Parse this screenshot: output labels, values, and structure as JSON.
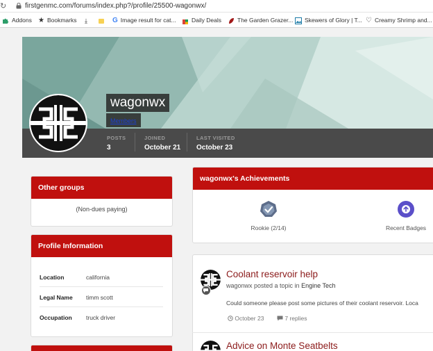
{
  "browser": {
    "url": "firstgenmc.com/forums/index.php?/profile/25500-wagonwx/",
    "bookmarks": [
      {
        "label": "Addons",
        "icon": "puzzle-icon"
      },
      {
        "label": "Bookmarks",
        "icon": "star-icon"
      },
      {
        "label": "",
        "icon": "download-icon"
      },
      {
        "label": "",
        "icon": "folder-icon"
      },
      {
        "label": "Image result for cat...",
        "icon": "google-icon"
      },
      {
        "label": "Daily Deals",
        "icon": "shopping-bag-icon"
      },
      {
        "label": "The Garden Grazer...",
        "icon": "leaf-icon"
      },
      {
        "label": "Skewers of Glory | T...",
        "icon": "image-icon"
      },
      {
        "label": "Creamy Shrimp and...",
        "icon": "heart-icon"
      }
    ]
  },
  "profile": {
    "username": "wagonwx",
    "role": "Members",
    "stats": [
      {
        "label": "POSTS",
        "value": "3"
      },
      {
        "label": "JOINED",
        "value": "October 21"
      },
      {
        "label": "LAST VISITED",
        "value": "October 23"
      }
    ]
  },
  "groups": {
    "title": "Other groups",
    "value": "(Non-dues paying)"
  },
  "info": {
    "title": "Profile Information",
    "rows": [
      {
        "key": "Location",
        "value": "california"
      },
      {
        "key": "Legal Name",
        "value": "timm scott"
      },
      {
        "key": "Occupation",
        "value": "truck driver"
      }
    ]
  },
  "achievements": {
    "title": "wagonwx's Achievements",
    "items": [
      {
        "label": "Rookie (2/14)",
        "icon": "rookie-badge-icon"
      },
      {
        "label": "Recent Badges",
        "icon": "arrow-up-circle-icon"
      }
    ]
  },
  "activity": [
    {
      "title": "Coolant reservoir help",
      "meta_prefix": "wagonwx posted a topic in ",
      "forum": "Engine Tech",
      "snippet": "Could someone please post some pictures of their coolant reservoir. Loca",
      "date": "October 23",
      "replies": "7 replies"
    },
    {
      "title": "Advice on Monte Seatbelts"
    }
  ],
  "colors": {
    "accent_red": "#c0100e",
    "cover_bar": "#4a4a4a",
    "title_maroon": "#8b1a1a"
  }
}
